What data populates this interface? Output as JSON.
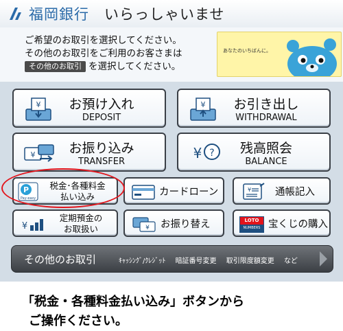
{
  "header": {
    "bank_name": "福岡銀行",
    "welcome": "いらっしゃいませ"
  },
  "info": {
    "line1": "ご希望のお取引を選択してください。",
    "line2": "その他のお取引をご利用のお客さまは",
    "tag": "その他のお取引",
    "line3_suffix": "を選択してください。",
    "ad_text": "あなたのいちばんに。"
  },
  "buttons": {
    "deposit": {
      "jp": "お預け入れ",
      "en": "DEPOSIT"
    },
    "withdrawal": {
      "jp": "お引き出し",
      "en": "WITHDRAWAL"
    },
    "transfer": {
      "jp": "お振り込み",
      "en": "TRANSFER"
    },
    "balance": {
      "jp": "残高照会",
      "en": "BALANCE"
    },
    "tax_payment": {
      "line1": "税金･各種料金",
      "line2": "払い込み",
      "icon_text": "Pay-easy"
    },
    "card_loan": {
      "label": "カードローン"
    },
    "passbook": {
      "label": "通帳記入"
    },
    "time_deposit": {
      "line1": "定期預金の",
      "line2": "お取扱い"
    },
    "account_transfer": {
      "label": "お振り替え"
    },
    "lottery": {
      "label": "宝くじの購入",
      "icon_top": "LOTO",
      "icon_bottom": "NUMBERS"
    }
  },
  "bottom_bar": {
    "title": "その他のお取引",
    "items": [
      "ｷｬｯｼﾝｸﾞ/ｸﾚｼﾞｯﾄ",
      "暗証番号変更",
      "取引限度額変更",
      "など"
    ]
  },
  "caption": {
    "line1": "「税金・各種料金払い込み」ボタンから",
    "line2": "ご操作ください。"
  },
  "colors": {
    "brand": "#2a6aa8",
    "highlight": "#e3141b",
    "background": "#d3dde6"
  }
}
